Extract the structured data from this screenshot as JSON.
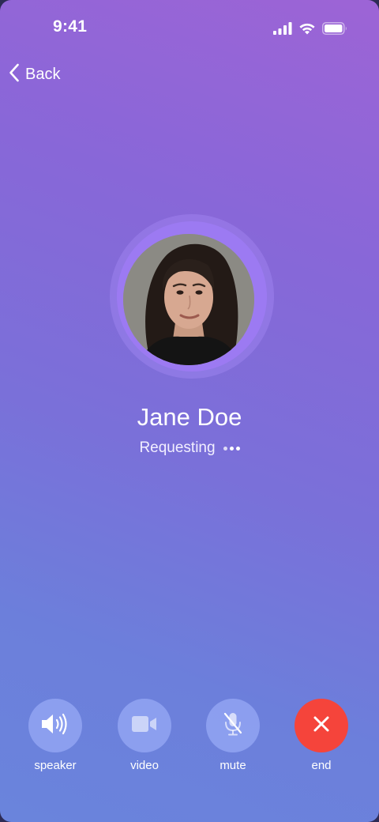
{
  "status_bar": {
    "time": "9:41",
    "icons": [
      "cellular-signal-icon",
      "wifi-icon",
      "battery-icon"
    ]
  },
  "nav": {
    "back_label": "Back"
  },
  "caller": {
    "name": "Jane Doe",
    "status": "Requesting",
    "avatar": "portrait-photo"
  },
  "controls": {
    "speaker_label": "speaker",
    "video_label": "video",
    "mute_label": "mute",
    "end_label": "end"
  },
  "colors": {
    "gradient_top": "#9d64d6",
    "gradient_bottom": "#6a84dc",
    "control_bg": "#a8b8ff",
    "end_call": "#f5443b",
    "avatar_ring": "#9c7af2"
  }
}
